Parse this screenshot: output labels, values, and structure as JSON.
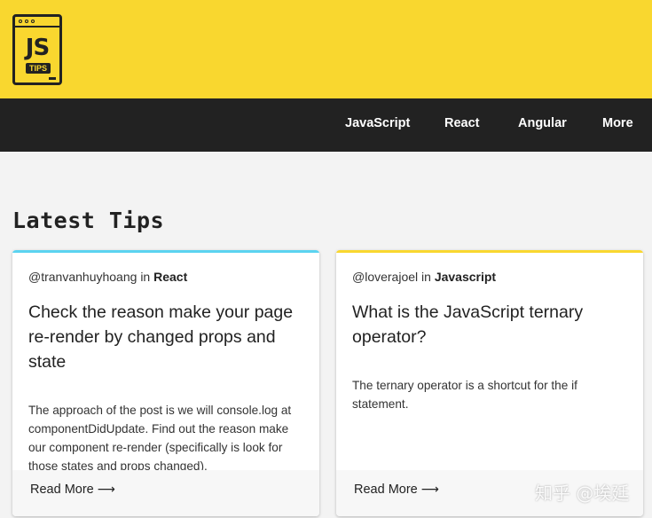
{
  "brand": {
    "logo_text": "JS",
    "logo_sub": "TIPS",
    "color": "#f9d72f"
  },
  "nav": {
    "items": [
      {
        "label": "JavaScript"
      },
      {
        "label": "React"
      },
      {
        "label": "Angular"
      },
      {
        "label": "More"
      }
    ]
  },
  "main": {
    "section_title": "Latest Tips",
    "cards": [
      {
        "author": "@tranvanhuyhoang",
        "in_word": "in",
        "category": "React",
        "accent_color": "#5bd3f0",
        "title": "Check the reason make your page re-render by changed props and state",
        "excerpt": "The approach of the post is we will console.log at componentDidUpdate. Find out the reason make our component re-render (specifically is look for those states and props changed).",
        "read_more": "Read More",
        "arrow": "⟶"
      },
      {
        "author": "@loverajoel",
        "in_word": "in",
        "category": "Javascript",
        "accent_color": "#f9d72f",
        "title": "What is the JavaScript ternary operator?",
        "excerpt": "The ternary operator is a shortcut for the if statement.",
        "read_more": "Read More",
        "arrow": "⟶"
      }
    ]
  },
  "watermark": "知乎 @埃廷"
}
